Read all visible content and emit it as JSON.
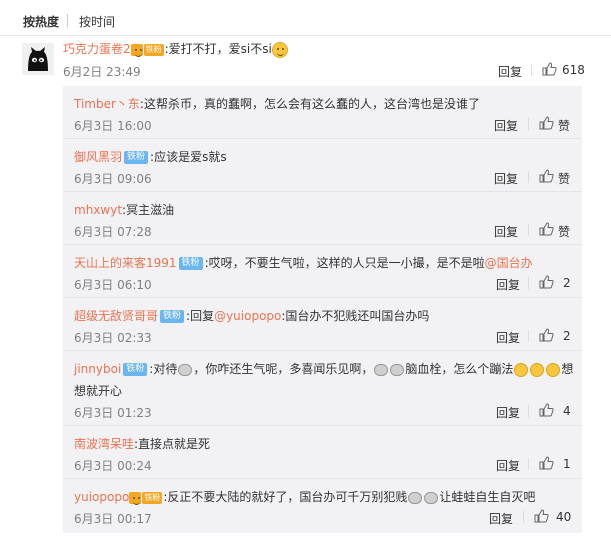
{
  "sort": {
    "hot": "按热度",
    "time": "按时间"
  },
  "main_comment": {
    "author": "巧克力蛋卷2",
    "badge": "vip",
    "text": ":爱打不打，爱si不si",
    "date": "6月2日 23:49",
    "reply": "回复",
    "likes": "618"
  },
  "replies": [
    {
      "author": "Timber丶东",
      "fan": "",
      "text": ":这帮杀币，真的蠢啊，怎么会有这么蠢的人，这台湾也是没谁了",
      "date": "6月3日 16:00",
      "reply": "回复",
      "likes": "赞"
    },
    {
      "author": "御风黑羽",
      "fan": "铁粉",
      "text": ":应该是爱s就s",
      "date": "6月3日 09:06",
      "reply": "回复",
      "likes": "赞"
    },
    {
      "author": "mhxwyt",
      "fan": "",
      "text": ":冥主滋油",
      "date": "6月3日 07:28",
      "reply": "回复",
      "likes": "赞"
    },
    {
      "author": "天山上的来客1991",
      "fan": "铁粉",
      "text": ":哎呀，不要生气啦，这样的人只是一小撮，是不是啦",
      "mention": "@国台办",
      "date": "6月3日 06:10",
      "reply": "回复",
      "likes": "2"
    },
    {
      "author": "超级无敌贤哥哥",
      "fan": "铁粉",
      "text_pre": ":回复",
      "mention": "@yuiopopo",
      "text": ":国台办不犯贱还叫国台办吗",
      "date": "6月3日 02:33",
      "reply": "回复",
      "likes": "2"
    },
    {
      "author": "jinnyboi",
      "fan": "铁粉",
      "text": ":对待",
      "text2": "，你咋还生气呢，多喜闻乐见啊，",
      "text3": "脑血栓，怎么个蹦法",
      "text4": "想",
      "line2": "想就开心",
      "date": "6月3日 01:23",
      "reply": "回复",
      "likes": "4"
    },
    {
      "author": "南波湾呆哇",
      "fan": "",
      "text": ":直接点就是死",
      "date": "6月3日 00:24",
      "reply": "回复",
      "likes": "1"
    },
    {
      "author": "yuiopopo",
      "fan": "vip",
      "text": ":反正不要大陆的就好了，国台办可千万别犯贱",
      "text2": "让蛙蛙自生自灭吧",
      "date": "6月3日 00:17",
      "reply": "回复",
      "likes": "40"
    }
  ]
}
